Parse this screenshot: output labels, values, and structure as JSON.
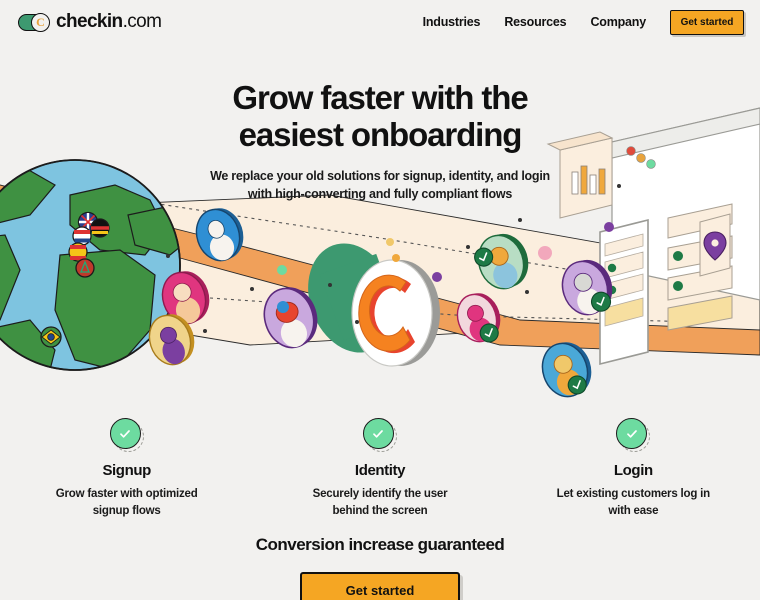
{
  "background_color": "#f2f1ef",
  "accent_color": "#f5a623",
  "success_color": "#6ddba0",
  "header": {
    "logo": {
      "name": "checkin",
      "suffix": ".com",
      "mark_letter": "C",
      "pill_color": "#3d9970",
      "letter_color": "#e8a33d"
    },
    "nav_items": [
      {
        "label": "Industries"
      },
      {
        "label": "Resources"
      },
      {
        "label": "Company"
      }
    ],
    "cta_label": "Get started"
  },
  "hero": {
    "title_line1": "Grow faster with the",
    "title_line2": "easiest onboarding",
    "subtitle_line1": "We replace your old solutions for signup, identity, and login",
    "subtitle_line2": "with high-converting and fully compliant flows"
  },
  "features": [
    {
      "icon": "check-circle-icon",
      "title": "Signup",
      "description_line1": "Grow faster with optimized",
      "description_line2": "signup flows"
    },
    {
      "icon": "check-circle-icon",
      "title": "Identity",
      "description_line1": "Securely identify the user",
      "description_line2": "behind the screen"
    },
    {
      "icon": "check-circle-icon",
      "title": "Login",
      "description_line1": "Let existing customers log in",
      "description_line2": "with ease"
    }
  ],
  "bottom": {
    "headline": "Conversion increase guaranteed",
    "cta_label": "Get started"
  },
  "illustration": {
    "globe": {
      "ocean_color": "#7ec4e0",
      "land_color": "#3f9142",
      "flags": [
        "uk-flag",
        "germany-flag",
        "netherlands-flag",
        "spain-flag",
        "morocco-flag",
        "brazil-flag"
      ]
    },
    "ribbon_orange_color": "#f0a05a",
    "ribbon_cream_color": "#fbeede",
    "center_logo": {
      "pill_color": "#3d9970",
      "disc_color": "#ffffff",
      "letter_color": "#f58220"
    },
    "browser_window": {
      "traffic_lights": [
        "red-dot",
        "amber-dot",
        "green-dot"
      ]
    },
    "avatars": [
      {
        "rim_color": "#2f7fc4",
        "name": "avatar-blue"
      },
      {
        "rim_color": "#e0357f",
        "name": "avatar-pink"
      },
      {
        "rim_color": "#e8b93f",
        "name": "avatar-yellow"
      },
      {
        "rim_color": "#7b3fa0",
        "name": "avatar-purple"
      },
      {
        "rim_color": "#2f8f57",
        "name": "avatar-green"
      },
      {
        "rim_color": "#a07bc4",
        "name": "avatar-lilac"
      },
      {
        "rim_color": "#e0357f",
        "name": "avatar-magenta"
      },
      {
        "rim_color": "#e8a33d",
        "name": "avatar-amber"
      }
    ]
  }
}
